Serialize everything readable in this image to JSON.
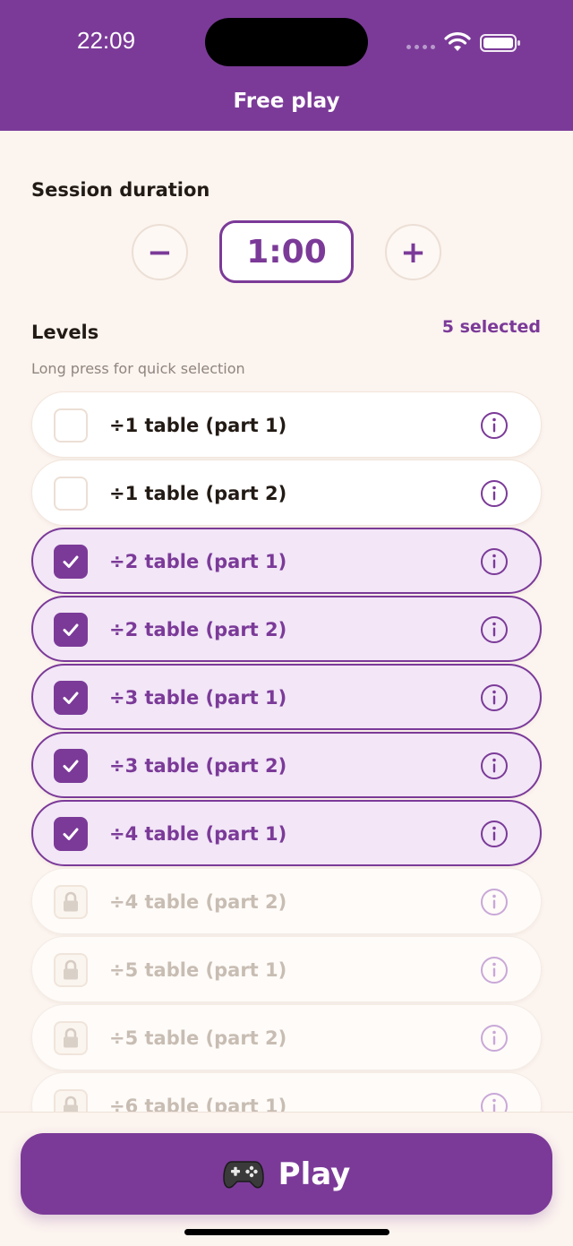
{
  "status_bar": {
    "time": "22:09"
  },
  "nav": {
    "title": "Free play"
  },
  "session": {
    "label": "Session duration",
    "decrement_label": "−",
    "increment_label": "+",
    "duration": "1:00"
  },
  "levels": {
    "label": "Levels",
    "selected_count": "5 selected",
    "hint": "Long press for quick selection",
    "items": [
      {
        "label": "÷1 table (part 1)",
        "state": "unchecked"
      },
      {
        "label": "÷1 table (part 2)",
        "state": "unchecked"
      },
      {
        "label": "÷2 table (part 1)",
        "state": "checked"
      },
      {
        "label": "÷2 table (part 2)",
        "state": "checked"
      },
      {
        "label": "÷3 table (part 1)",
        "state": "checked"
      },
      {
        "label": "÷3 table (part 2)",
        "state": "checked"
      },
      {
        "label": "÷4 table (part 1)",
        "state": "checked"
      },
      {
        "label": "÷4 table (part 2)",
        "state": "locked"
      },
      {
        "label": "÷5 table (part 1)",
        "state": "locked"
      },
      {
        "label": "÷5 table (part 2)",
        "state": "locked"
      },
      {
        "label": "÷6 table (part 1)",
        "state": "locked"
      }
    ]
  },
  "play": {
    "icon": "gamepad-icon",
    "label": "Play"
  },
  "colors": {
    "brand": "#7b3a98",
    "background": "#fcf4ef",
    "selected_row": "#f2e6f7",
    "locked_text": "#c8bdb3"
  }
}
